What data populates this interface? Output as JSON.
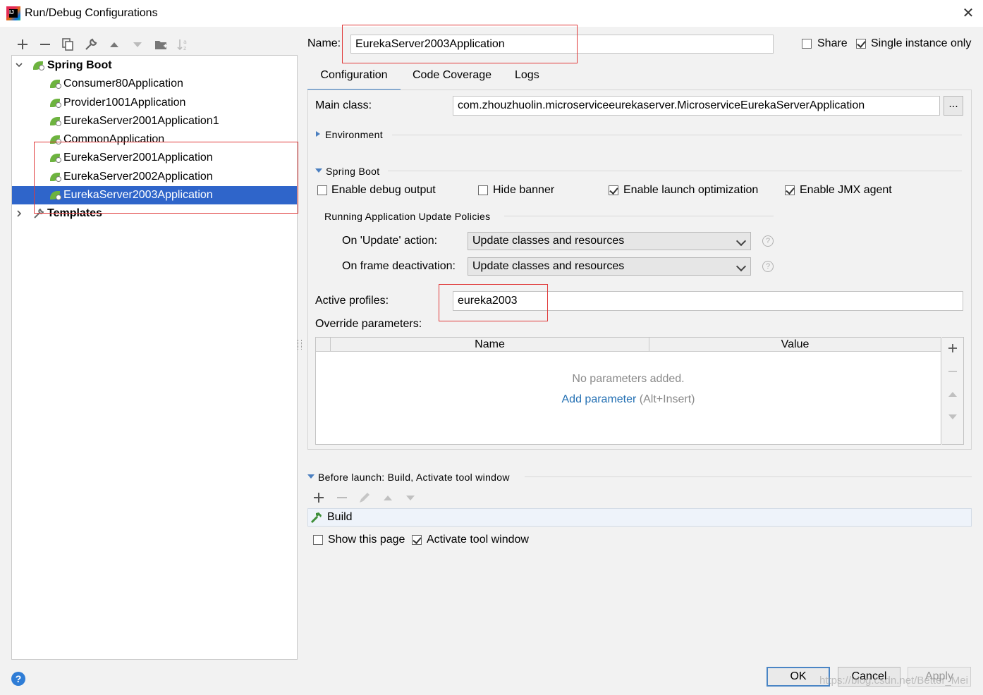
{
  "window": {
    "title": "Run/Debug Configurations",
    "close_glyph": "✕"
  },
  "toolbar": {
    "icons": [
      "add-icon",
      "remove-icon",
      "copy-icon",
      "wrench-icon",
      "move-up-icon",
      "move-down-icon",
      "folder-icon",
      "sort-icon"
    ]
  },
  "tree": {
    "group_label": "Spring Boot",
    "items": [
      "Consumer80Application",
      "Provider1001Application",
      "EurekaServer2001Application1",
      "CommonApplication",
      "EurekaServer2001Application",
      "EurekaServer2002Application",
      "EurekaServer2003Application"
    ],
    "selected_index": 6,
    "templates_label": "Templates"
  },
  "name_row": {
    "label": "Name:",
    "value": "EurekaServer2003Application",
    "share_label": "Share",
    "share_checked": false,
    "single_instance_label": "Single instance only",
    "single_instance_checked": true
  },
  "tabs": {
    "items": [
      "Configuration",
      "Code Coverage",
      "Logs"
    ],
    "active": "Configuration"
  },
  "config": {
    "main_class_label": "Main class:",
    "main_class_value": "com.zhouzhuolin.microserviceeurekaserver.MicroserviceEurekaServerApplication",
    "browse_label": "...",
    "environment_label": "Environment",
    "spring_boot_label": "Spring Boot",
    "enable_debug_label": "Enable debug output",
    "enable_debug_checked": false,
    "hide_banner_label": "Hide banner",
    "hide_banner_checked": false,
    "launch_opt_label": "Enable launch optimization",
    "launch_opt_checked": true,
    "jmx_label": "Enable JMX agent",
    "jmx_checked": true,
    "policies_label": "Running Application Update Policies",
    "on_update_label": "On 'Update' action:",
    "on_update_value": "Update classes and resources",
    "on_frame_label": "On frame deactivation:",
    "on_frame_value": "Update classes and resources",
    "help_glyph": "?",
    "active_profiles_label": "Active profiles:",
    "active_profiles_value": "eureka2003",
    "override_label": "Override parameters:",
    "table_headers": [
      "Name",
      "Value"
    ],
    "empty_text": "No parameters added.",
    "add_param_link": "Add parameter",
    "add_param_shortcut": "(Alt+Insert)"
  },
  "before_launch": {
    "label": "Before launch: Build, Activate tool window",
    "items": [
      "Build"
    ],
    "show_page_label": "Show this page",
    "show_page_checked": false,
    "activate_label": "Activate tool window",
    "activate_checked": true
  },
  "buttons": {
    "ok": "OK",
    "cancel": "Cancel",
    "apply": "Apply",
    "help": "?"
  },
  "watermark": "https://blog.csdn.net/Better_Mei"
}
